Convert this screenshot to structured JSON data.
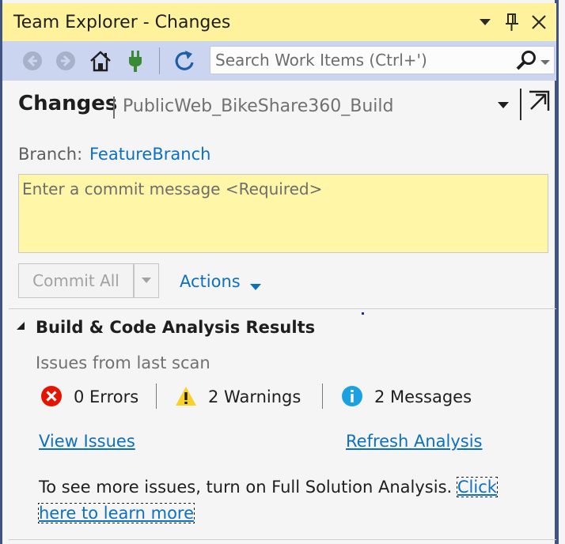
{
  "window": {
    "title": "Team Explorer - Changes"
  },
  "toolbar": {
    "search_placeholder": "Search Work Items (Ctrl+')"
  },
  "header": {
    "title": "Changes",
    "repo": "PublicWeb_BikeShare360_Build"
  },
  "branch": {
    "label": "Branch:",
    "name": "FeatureBranch"
  },
  "commit": {
    "placeholder": "Enter a commit message <Required>",
    "button_label": "Commit All",
    "actions_label": "Actions"
  },
  "analysis": {
    "section_title": "Build & Code Analysis Results",
    "subtitle": "Issues from last scan",
    "errors": "0 Errors",
    "warnings": "2 Warnings",
    "messages": "2 Messages",
    "view_issues": "View Issues",
    "refresh": "Refresh Analysis",
    "info_text": "To see more issues, turn on Full Solution Analysis.",
    "learn_more": "Click here to learn more"
  },
  "colors": {
    "title_bar": "#fff29d",
    "toolbar": "#ccd5f0",
    "link": "#0e70c0",
    "error": "#e51400",
    "warning": "#f8d12a",
    "info": "#1ba1e2"
  }
}
